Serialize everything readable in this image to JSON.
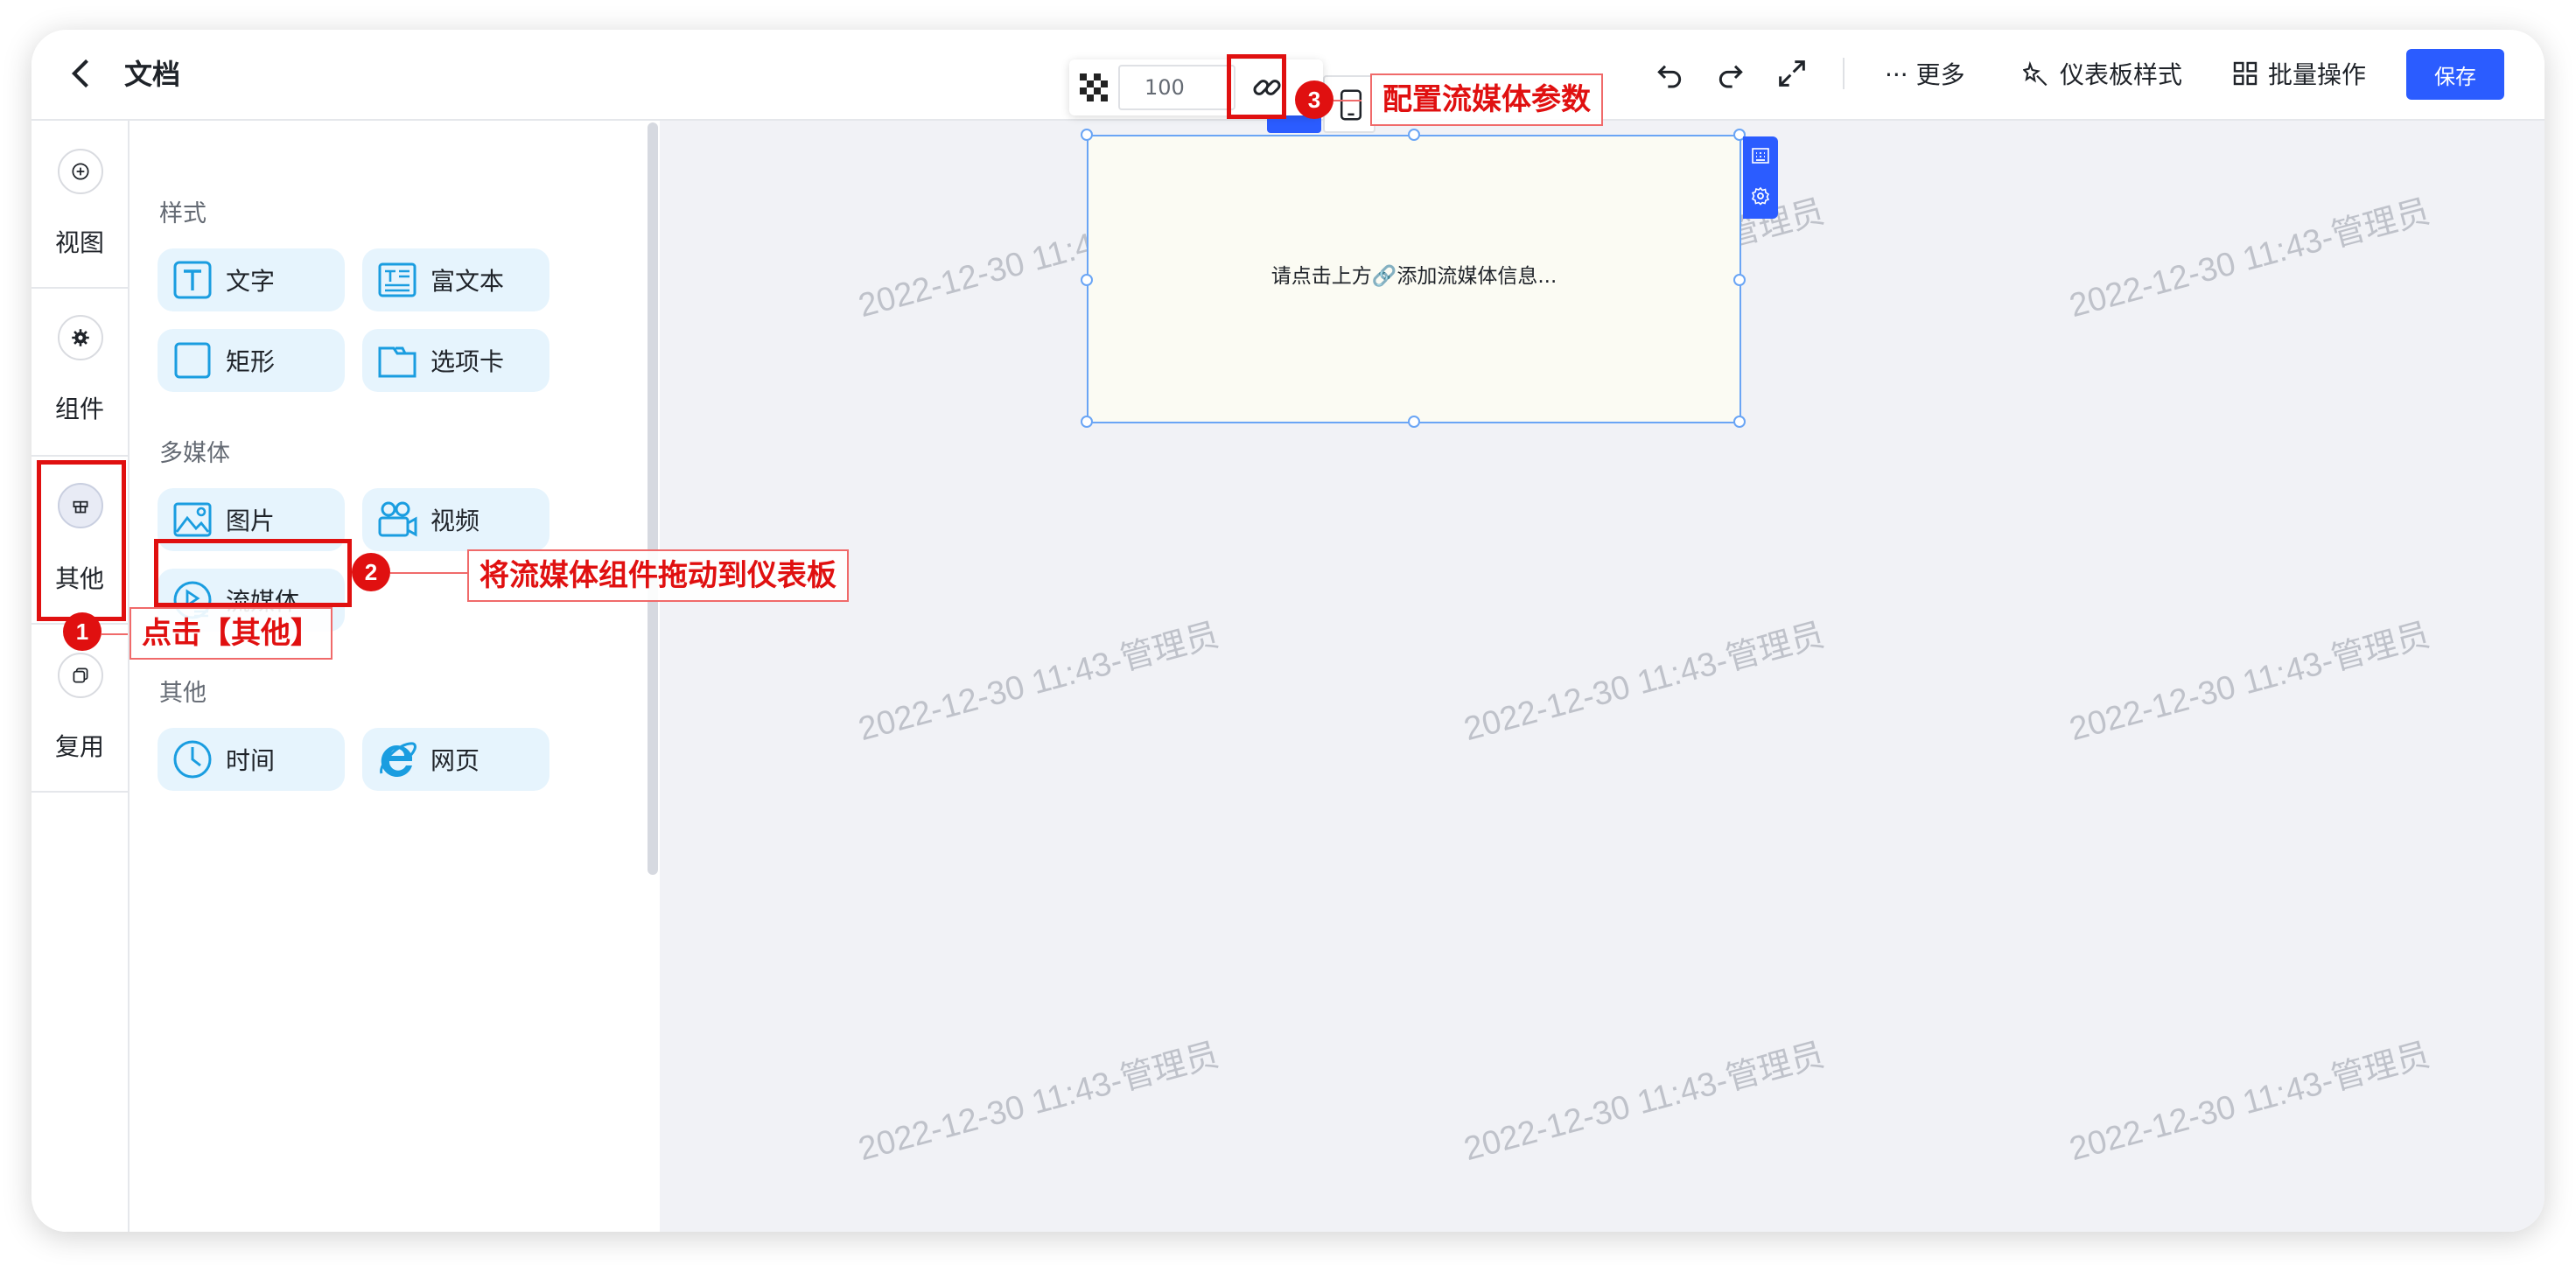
{
  "header": {
    "title": "文档",
    "more_label": "··· 更多",
    "style_label": "仪表板样式",
    "batch_label": "批量操作",
    "save_label": "保存"
  },
  "leftnav": {
    "items": [
      {
        "label": "视图",
        "icon": "plus-circle-icon"
      },
      {
        "label": "组件",
        "icon": "gear-icon"
      },
      {
        "label": "其他",
        "icon": "gift-icon"
      },
      {
        "label": "复用",
        "icon": "copy-icon"
      }
    ]
  },
  "panel": {
    "sections": [
      {
        "title": "样式",
        "items": [
          {
            "label": "文字",
            "icon": "text-icon"
          },
          {
            "label": "富文本",
            "icon": "rich-text-icon"
          },
          {
            "label": "矩形",
            "icon": "rectangle-icon"
          },
          {
            "label": "选项卡",
            "icon": "tab-icon"
          }
        ]
      },
      {
        "title": "多媒体",
        "items": [
          {
            "label": "图片",
            "icon": "image-icon"
          },
          {
            "label": "视频",
            "icon": "video-icon"
          },
          {
            "label": "流媒体",
            "icon": "stream-icon"
          }
        ]
      },
      {
        "title": "其他",
        "items": [
          {
            "label": "时间",
            "icon": "clock-icon"
          },
          {
            "label": "网页",
            "icon": "ie-icon"
          }
        ]
      }
    ]
  },
  "toolbar_popup": {
    "opacity_value": "100"
  },
  "canvas": {
    "watermark": "2022-12-30 11:43-管理员",
    "widget_placeholder": "请点击上方🔗添加流媒体信息..."
  },
  "annotations": [
    {
      "number": "1",
      "text": "点击【其他】"
    },
    {
      "number": "2",
      "text": "将流媒体组件拖动到仪表板"
    },
    {
      "number": "3",
      "text": "配置流媒体参数"
    }
  ],
  "colors": {
    "accent": "#2b5cff",
    "annotation_red": "#e01010",
    "chip_bg": "#e6f4fd",
    "canvas_bg": "#f1f2f6"
  }
}
